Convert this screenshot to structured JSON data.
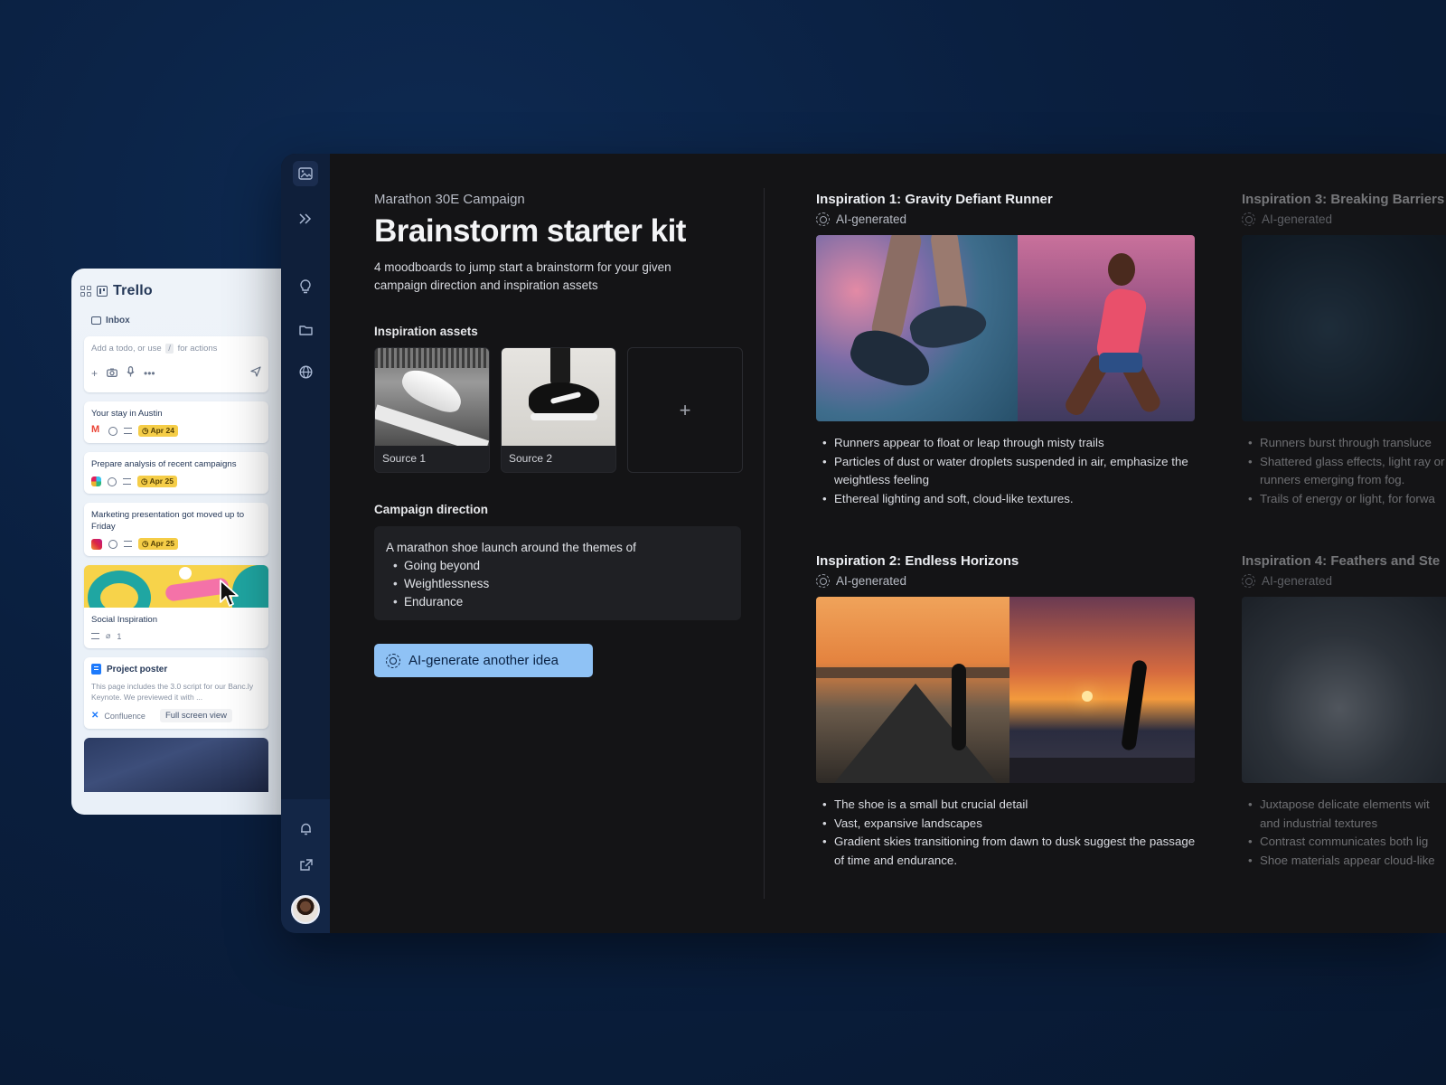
{
  "trello": {
    "title": "Trello",
    "inbox_label": "Inbox",
    "todo_placeholder_a": "Add a todo, or use",
    "todo_placeholder_slash": "/",
    "todo_placeholder_b": "for actions",
    "cards": [
      {
        "title": "Your stay in Austin",
        "date": "Apr 24"
      },
      {
        "title": "Prepare analysis of recent campaigns",
        "date": "Apr 25"
      },
      {
        "title": "Marketing presentation got moved up to Friday",
        "date": "Apr 25"
      }
    ],
    "image_card": {
      "title": "Social Inspiration",
      "attachments": "1"
    },
    "confluence_card": {
      "title": "Project poster",
      "description": "This page includes the 3.0 script for our Banc.ly Keynote. We previewed it with ...",
      "source": "Confluence",
      "action": "Full screen view"
    }
  },
  "main": {
    "campaign": "Marathon 30E Campaign",
    "title": "Brainstorm starter kit",
    "subtitle": "4 moodboards to jump start a brainstorm for your given campaign direction and inspiration assets",
    "assets_label": "Inspiration assets",
    "assets": [
      {
        "caption": "Source 1"
      },
      {
        "caption": "Source 2"
      }
    ],
    "add_asset": "+",
    "direction_label": "Campaign direction",
    "direction_intro": "A marathon shoe launch around the themes of",
    "direction_items": [
      "Going beyond",
      "Weightlessness",
      "Endurance"
    ],
    "generate_button": "AI-generate another idea"
  },
  "inspirations": [
    {
      "title": "Inspiration 1: Gravity Defiant Runner",
      "tag": "AI-generated",
      "bullets": [
        "Runners appear to float or leap through misty trails",
        "Particles of dust or water droplets suspended in air, emphasize the weightless feeling",
        "Ethereal lighting and soft, cloud-like textures."
      ]
    },
    {
      "title": "Inspiration 2: Endless Horizons",
      "tag": "AI-generated",
      "bullets": [
        "The shoe is a small but crucial detail",
        "Vast, expansive landscapes",
        "Gradient skies transitioning from dawn to dusk suggest the passage of time and endurance."
      ]
    },
    {
      "title": "Inspiration 3: Breaking Barriers",
      "tag": "AI-generated",
      "bullets": [
        "Runners burst through transluce",
        "Shattered glass effects, light ray or runners emerging from fog.",
        "Trails of energy or light, for forwa"
      ]
    },
    {
      "title": "Inspiration 4: Feathers and Ste",
      "tag": "AI-generated",
      "bullets": [
        "Juxtapose delicate elements wit and industrial textures",
        "Contrast communicates both lig",
        "Shoe materials appear cloud-like"
      ]
    }
  ],
  "rail": {
    "icons": [
      "image-icon",
      "expand-icon",
      "lightbulb-icon",
      "folder-icon",
      "globe-icon",
      "bell-icon",
      "share-icon"
    ]
  },
  "colors": {
    "background": "#0a1f3f",
    "app": "#141416",
    "rail": "#0f1f3a",
    "accent_button": "#8fc2f5",
    "date_badge": "#f5cd47"
  }
}
